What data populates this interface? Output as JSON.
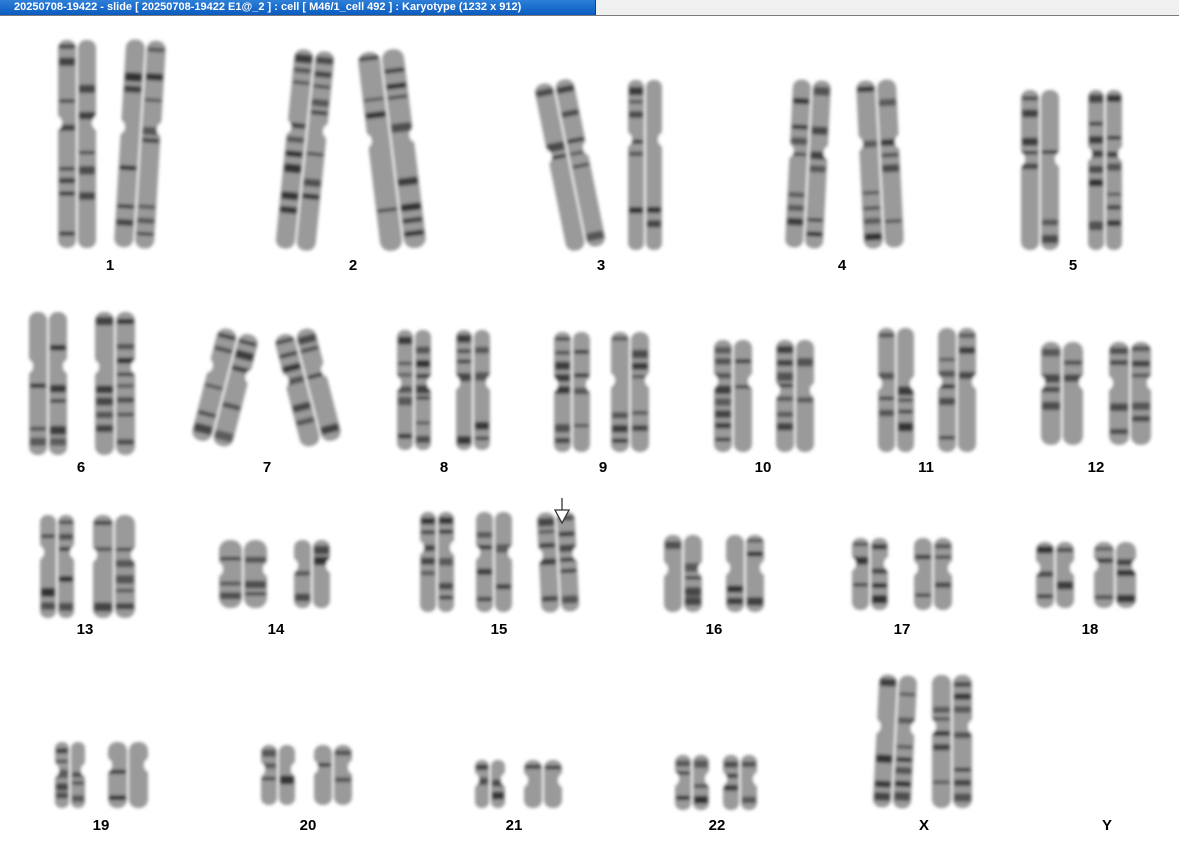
{
  "window": {
    "title": "20250708-19422 - slide [ 20250708-19422 E1@_2 ] : cell [ M46/1_cell 492 ] : Karyotype  (1232 x 912)"
  },
  "karyotype": {
    "chromosomes": [
      {
        "label": "1",
        "count": 2
      },
      {
        "label": "2",
        "count": 2
      },
      {
        "label": "3",
        "count": 2
      },
      {
        "label": "4",
        "count": 2
      },
      {
        "label": "5",
        "count": 2
      },
      {
        "label": "6",
        "count": 2
      },
      {
        "label": "7",
        "count": 2
      },
      {
        "label": "8",
        "count": 2
      },
      {
        "label": "9",
        "count": 2
      },
      {
        "label": "10",
        "count": 2
      },
      {
        "label": "11",
        "count": 2
      },
      {
        "label": "12",
        "count": 2
      },
      {
        "label": "13",
        "count": 2
      },
      {
        "label": "14",
        "count": 2
      },
      {
        "label": "15",
        "count": 3
      },
      {
        "label": "16",
        "count": 2
      },
      {
        "label": "17",
        "count": 2
      },
      {
        "label": "18",
        "count": 2
      },
      {
        "label": "19",
        "count": 2
      },
      {
        "label": "20",
        "count": 2
      },
      {
        "label": "21",
        "count": 2
      },
      {
        "label": "22",
        "count": 2
      },
      {
        "label": "X",
        "count": 2
      },
      {
        "label": "Y",
        "count": 0
      }
    ],
    "marker": {
      "pointer": "down-arrow-icon",
      "target": "15"
    },
    "colors": {
      "band_dark": "#2a2a2a",
      "band_light": "#9a9a9a",
      "background": "#ffffff",
      "title_bar": "#0a5bbf"
    }
  }
}
